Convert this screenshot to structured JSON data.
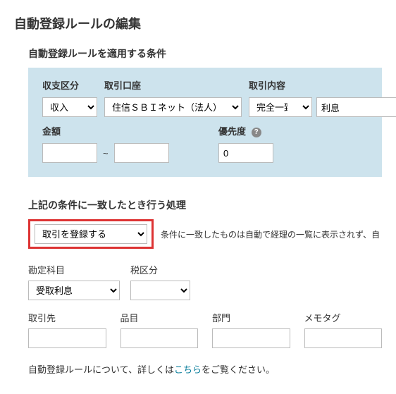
{
  "page_title": "自動登録ルールの編集",
  "condition_heading": "自動登録ルールを適用する条件",
  "labels": {
    "balance_type": "収支区分",
    "account": "取引口座",
    "content": "取引内容",
    "amount": "金額",
    "priority": "優先度",
    "action_heading": "上記の条件に一致したとき行う処理",
    "account_item": "勘定科目",
    "tax_type": "税区分",
    "partner": "取引先",
    "item": "品目",
    "section": "部門",
    "memo_tag": "メモタグ"
  },
  "condition": {
    "balance_type_value": "収入",
    "account_value": "住信ＳＢＩネット（法人）",
    "match_type_value": "完全一致",
    "content_value": "利息",
    "amount_from": "",
    "amount_to": "",
    "priority_value": "0"
  },
  "symbols": {
    "tilde": "~",
    "help": "?"
  },
  "action": {
    "select_value": "取引を登録する",
    "note": "条件に一致したものは自動で経理の一覧に表示されず、自",
    "account_item_value": "受取利息",
    "tax_type_value": "",
    "partner_value": "",
    "item_value": "",
    "section_value": "",
    "memo_tag_value": ""
  },
  "footer": {
    "prefix": "自動登録ルールについて、詳しくは",
    "link_text": "こちら",
    "suffix": "をご覧ください。"
  }
}
